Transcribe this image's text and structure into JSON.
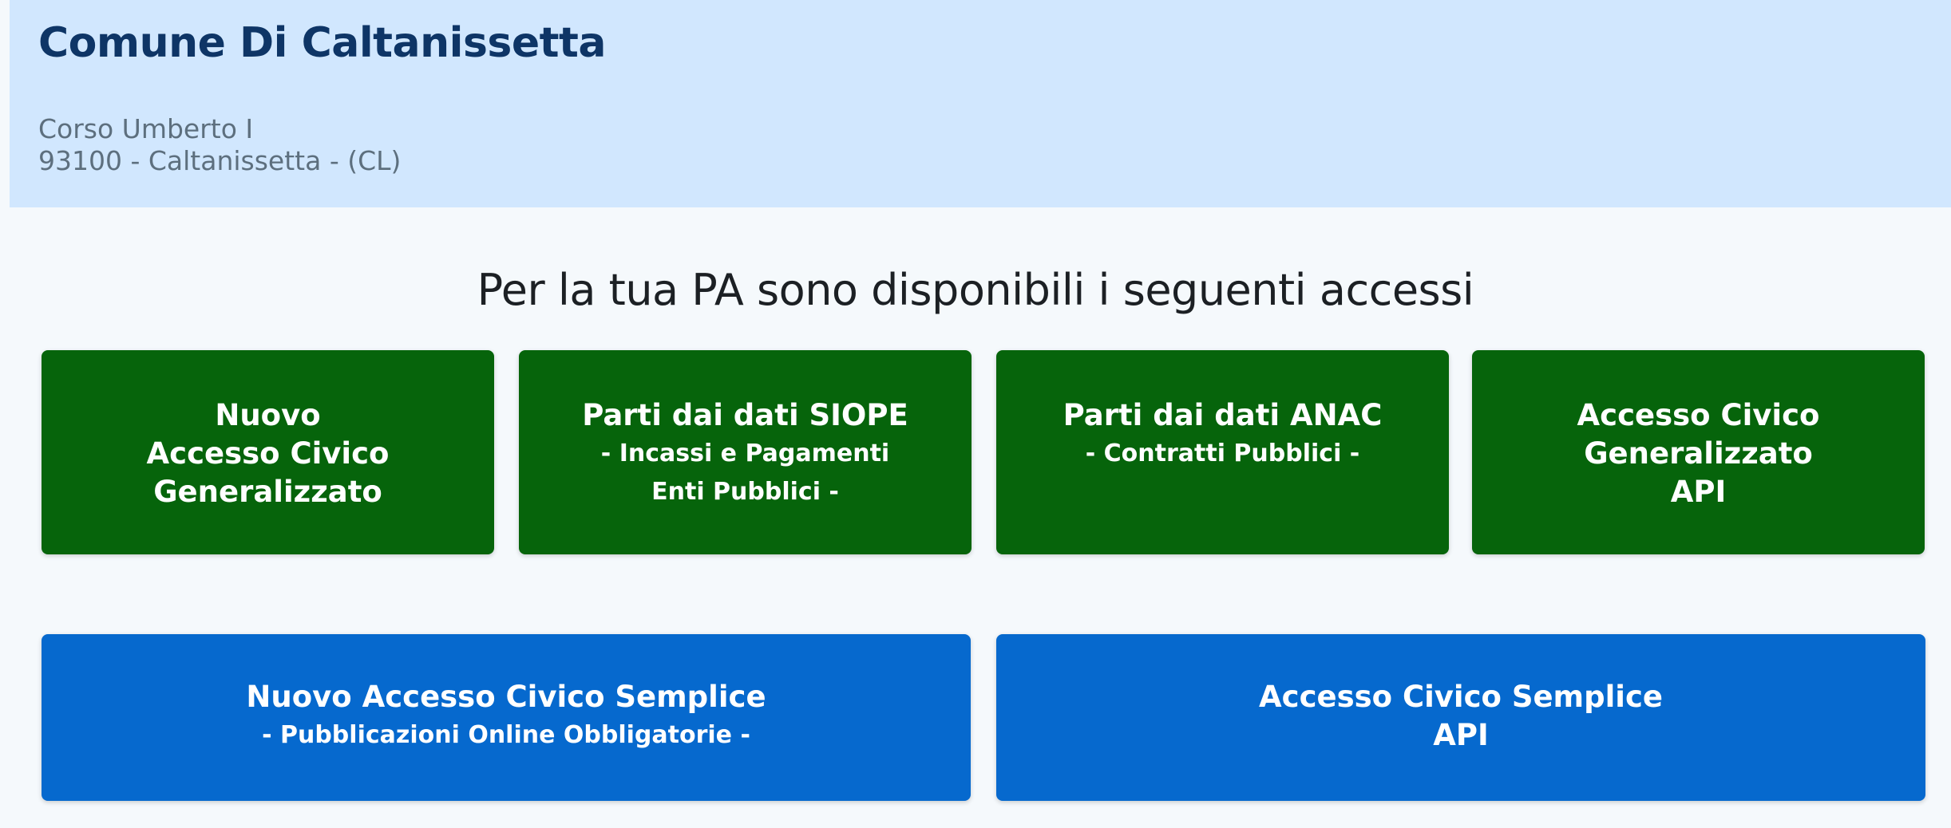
{
  "header": {
    "org_name": "Comune Di Caltanissetta",
    "address_line1": "Corso Umberto I",
    "address_line2": "93100 - Caltanissetta - (CL)"
  },
  "intro": "Per la tua PA sono disponibili i seguenti accessi",
  "cards_green": [
    {
      "line1": "Nuovo",
      "line2": "Accesso Civico",
      "line3": "Generalizzato"
    },
    {
      "line1": "Parti dai dati SIOPE",
      "sub1": "- Incassi e Pagamenti",
      "sub2": "Enti Pubblici -"
    },
    {
      "line1": "Parti dai dati ANAC",
      "sub1": "- Contratti Pubblici -"
    },
    {
      "line1": "Accesso Civico",
      "line2": "Generalizzato",
      "line3": "API"
    }
  ],
  "cards_blue": [
    {
      "line1": "Nuovo Accesso Civico Semplice",
      "sub1": "- Pubblicazioni Online Obbligatorie -"
    },
    {
      "line1": "Accesso Civico Semplice",
      "line2": "API"
    }
  ],
  "colors": {
    "header_bg": "#d1e7fe",
    "page_bg": "#f5f9fc",
    "green_card": "#06640b",
    "blue_card": "#0669ce",
    "org_name": "#0e3566"
  }
}
